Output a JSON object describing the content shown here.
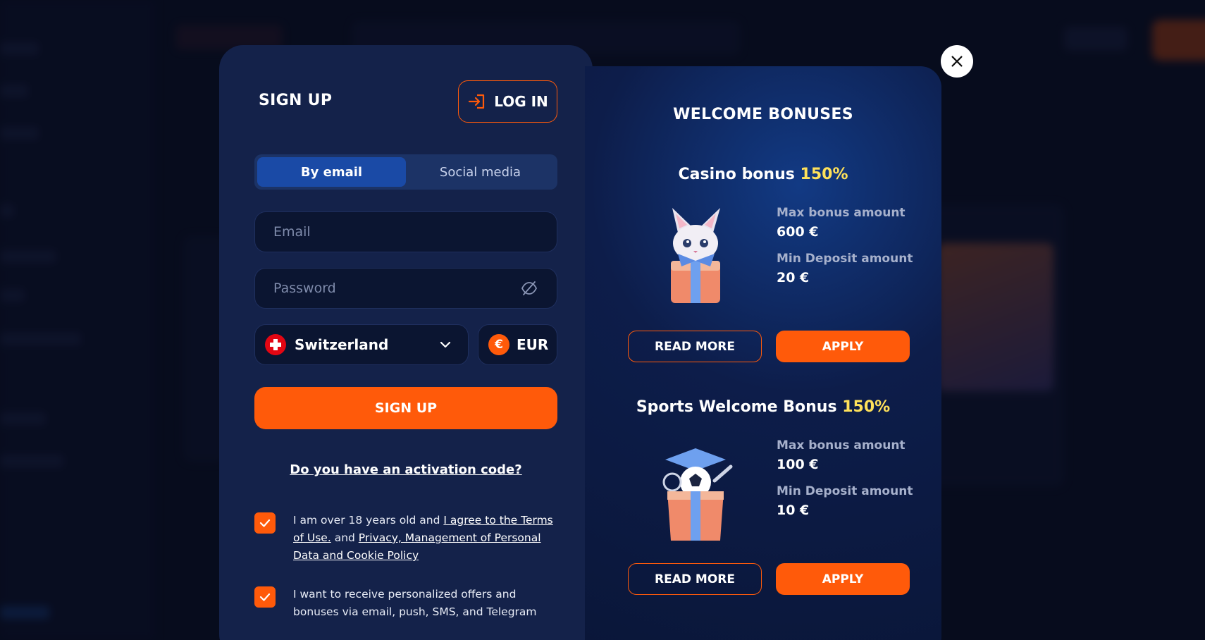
{
  "signup": {
    "title": "SIGN UP",
    "login_label": "LOG IN",
    "tabs": [
      {
        "label": "By email",
        "active": true
      },
      {
        "label": "Social media",
        "active": false
      }
    ],
    "email_placeholder": "Email",
    "password_placeholder": "Password",
    "country": "Switzerland",
    "currency": "EUR",
    "currency_symbol": "€",
    "submit_label": "SIGN UP",
    "activation_link": "Do you have an activation code?",
    "consent_1": {
      "prefix": "I am over 18 years old and ",
      "terms_link": "I agree to the Terms of Use.",
      "middle": " and ",
      "privacy_link": "Privacy, Management of Personal Data and Cookie Policy"
    },
    "consent_2": "I want to receive personalized offers and bonuses via email, push, SMS, and Telegram"
  },
  "bonuses": {
    "title": "WELCOME BONUSES",
    "items": [
      {
        "name": "Casino bonus",
        "percent": "150%",
        "max_label": "Max bonus amount",
        "max_value": "600 €",
        "min_label": "Min Deposit amount",
        "min_value": "20 €",
        "read_more": "READ MORE",
        "apply": "APPLY"
      },
      {
        "name": "Sports Welcome Bonus",
        "percent": "150%",
        "max_label": "Max bonus amount",
        "max_value": "100 €",
        "min_label": "Min Deposit amount",
        "min_value": "10 €",
        "read_more": "READ MORE",
        "apply": "APPLY"
      }
    ]
  },
  "colors": {
    "accent": "#ff5a0a",
    "highlight": "#ffe15a",
    "panel": "#14224a"
  }
}
